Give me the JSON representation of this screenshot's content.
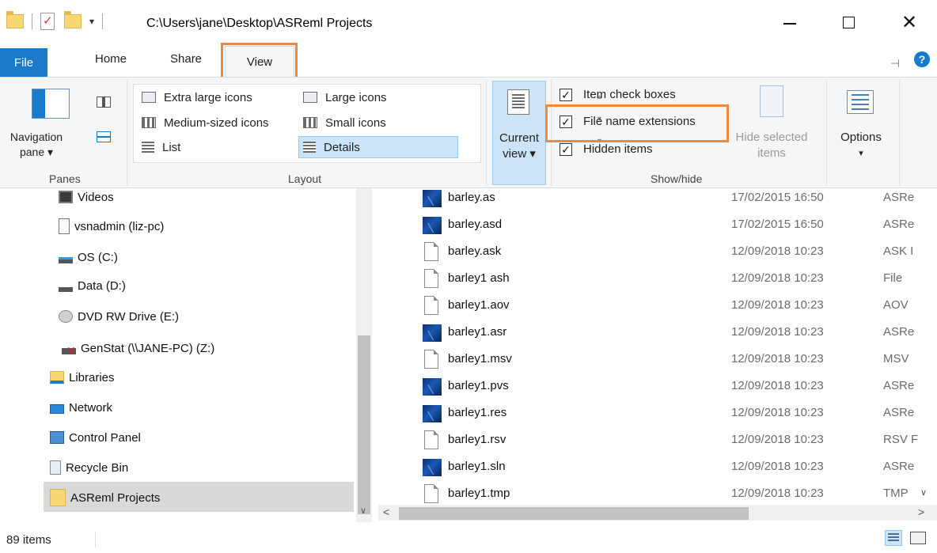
{
  "window": {
    "title": "C:\\Users\\jane\\Desktop\\ASReml Projects",
    "qat_dropdown": "▾",
    "minimize": "",
    "maximize": "",
    "close": "✕"
  },
  "ribbon_tabs": {
    "file": "File",
    "home": "Home",
    "share": "Share",
    "view": "View",
    "active": "View"
  },
  "ribbon": {
    "panes": {
      "navigation_pane": "Navigation\npane ▾",
      "group_label": "Panes"
    },
    "layout": {
      "items": [
        {
          "label": "Extra large icons",
          "icon": "extra-large-icons-icon"
        },
        {
          "label": "Large icons",
          "icon": "large-icons-icon"
        },
        {
          "label": "Medium-sized icons",
          "icon": "medium-icons-icon"
        },
        {
          "label": "Small icons",
          "icon": "small-icons-icon"
        },
        {
          "label": "List",
          "icon": "list-view-icon"
        },
        {
          "label": "Details",
          "icon": "details-view-icon"
        }
      ],
      "selected": "Details",
      "group_label": "Layout"
    },
    "current_view": {
      "label": "Current\nview ▾"
    },
    "show_hide": {
      "item_check_boxes": {
        "label": "Item check boxes",
        "checked": true
      },
      "file_name_extensions": {
        "label": "File name extensions",
        "checked": true
      },
      "hidden_items": {
        "label": "Hidden items",
        "checked": true
      },
      "hide_selected_items": "Hide selected\nitems",
      "group_label": "Show/hide"
    },
    "options": {
      "label": "Options",
      "dropdown": "▾"
    }
  },
  "nav_pane": {
    "items": [
      {
        "label": "Videos",
        "icon": "videos-folder-icon"
      },
      {
        "label": "vsnadmin (liz-pc)",
        "icon": "network-user-icon"
      },
      {
        "label": "OS (C:)",
        "icon": "os-drive-icon"
      },
      {
        "label": "Data (D:)",
        "icon": "drive-icon"
      },
      {
        "label": "DVD RW Drive (E:)",
        "icon": "dvd-drive-icon"
      },
      {
        "label": "GenStat (\\\\JANE-PC) (Z:)",
        "icon": "disconnected-network-drive-icon"
      },
      {
        "label": "Libraries",
        "icon": "libraries-icon"
      },
      {
        "label": "Network",
        "icon": "network-icon"
      },
      {
        "label": "Control Panel",
        "icon": "control-panel-icon"
      },
      {
        "label": "Recycle Bin",
        "icon": "recycle-bin-icon"
      },
      {
        "label": "ASReml Projects",
        "icon": "folder-icon"
      }
    ],
    "selected": "ASReml Projects"
  },
  "files": [
    {
      "name": "barley.as",
      "date": "17/02/2015 16:50",
      "type": "ASRe",
      "icon": "asreml-file-icon"
    },
    {
      "name": "barley.asd",
      "date": "17/02/2015 16:50",
      "type": "ASRe",
      "icon": "asreml-file-icon"
    },
    {
      "name": "barley.ask",
      "date": "12/09/2018 10:23",
      "type": "ASK I",
      "icon": "generic-file-icon"
    },
    {
      "name": "barley1 ash",
      "date": "12/09/2018 10:23",
      "type": "File",
      "icon": "generic-file-icon"
    },
    {
      "name": "barley1.aov",
      "date": "12/09/2018 10:23",
      "type": "AOV",
      "icon": "generic-file-icon"
    },
    {
      "name": "barley1.asr",
      "date": "12/09/2018 10:23",
      "type": "ASRe",
      "icon": "asreml-file-icon"
    },
    {
      "name": "barley1.msv",
      "date": "12/09/2018 10:23",
      "type": "MSV",
      "icon": "generic-file-icon"
    },
    {
      "name": "barley1.pvs",
      "date": "12/09/2018 10:23",
      "type": "ASRe",
      "icon": "asreml-file-icon"
    },
    {
      "name": "barley1.res",
      "date": "12/09/2018 10:23",
      "type": "ASRe",
      "icon": "asreml-file-icon"
    },
    {
      "name": "barley1.rsv",
      "date": "12/09/2018 10:23",
      "type": "RSV F",
      "icon": "generic-file-icon"
    },
    {
      "name": "barley1.sln",
      "date": "12/09/2018 10:23",
      "type": "ASRe",
      "icon": "asreml-file-icon"
    },
    {
      "name": "barley1.tmp",
      "date": "12/09/2018 10:23",
      "type": "TMP",
      "icon": "generic-file-icon"
    }
  ],
  "status": {
    "item_count": "89 items"
  },
  "colors": {
    "accent": "#1979ca",
    "highlight_box": "#f0883a",
    "selection": "#cce4f7"
  }
}
